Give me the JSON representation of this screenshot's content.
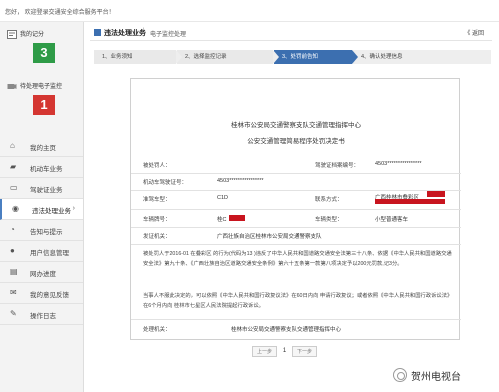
{
  "greeting": "您好，          欢迎登录交通安全综合服务平台！",
  "sidebar": {
    "stats": [
      {
        "label": "我的记分",
        "value": "3",
        "icon": "score-icon"
      },
      {
        "label": "待处理电子监控",
        "value": "1",
        "icon": "camera-icon"
      }
    ],
    "items": [
      {
        "label": "我的主页",
        "icon": "home-icon"
      },
      {
        "label": "机动车业务",
        "icon": "car-icon"
      },
      {
        "label": "驾驶证业务",
        "icon": "license-icon"
      },
      {
        "label": "违法处理业务",
        "icon": "camera-icon",
        "arrow": "›"
      },
      {
        "label": "告知与提示",
        "icon": "bell-icon"
      },
      {
        "label": "用户信息管理",
        "icon": "user-icon"
      },
      {
        "label": "网办进度",
        "icon": "progress-icon"
      },
      {
        "label": "我的意见反馈",
        "icon": "feedback-icon"
      },
      {
        "label": "操作日志",
        "icon": "log-icon"
      }
    ]
  },
  "crumb": {
    "title": "违法处理业务",
    "sep": "/",
    "sub": "电子监控处理",
    "back": "《 返回"
  },
  "steps": [
    "1、业务须知",
    "2、选择监控记录",
    "3、处罚前告知",
    "4、确认处理信息"
  ],
  "doc": {
    "org": "桂林市公安局交通警察支队交通管理指挥中心",
    "title": "公安交通管理简易程序处罚决定书",
    "f_party": "被处罚人：",
    "f_dlnum": "驾驶证档案编号：",
    "f_dlnum_val": "4503****************",
    "f_idcard": "机动车驾驶证号：",
    "f_idcard_val": "4503****************",
    "f_class": "准驾车型：",
    "f_class_val": "C1D",
    "f_contact": "联系方式：",
    "f_contact_val": "广西桂林市叠彩区",
    "f_plate": "车辆牌号：",
    "f_plate_val": "桂C",
    "f_vtype": "车辆类型：",
    "f_vtype_val": "小型普通客车",
    "f_place": "发证机关：",
    "f_place_val": "广西壮族自治区桂林市公安局交通警察支队",
    "p1": "被处罚人于2016-01              在叠彩区           的行为(代码为13      )违反了中华人民共和国道路交通安全法第三十八条、依据《中华人民共和国道路交通安全法》第九十条、《广西壮族自治区道路交通安全条例》第六十五条第一款第八项决定予以200元罚款,记3分。",
    "p2": "当事人不服此决定的，可以依照《中华人民共和国行政复议法》在60日内向      申请行政复议；或者依照《中华人民共和国行政诉讼法》在6个月内向      桂林市七星区人民法院提起行政诉讼。",
    "f_org": "处理机关：",
    "f_org_val": "桂林市公安局交通警察支队交通管理指挥中心"
  },
  "pager": {
    "prev": "上一步",
    "page": "1",
    "next": "下一步"
  },
  "watermark": "贺州电视台",
  "colors": {
    "accent": "#3c6fb0",
    "green": "#2e9b47",
    "red": "#d43631",
    "redact": "#c8141e"
  }
}
